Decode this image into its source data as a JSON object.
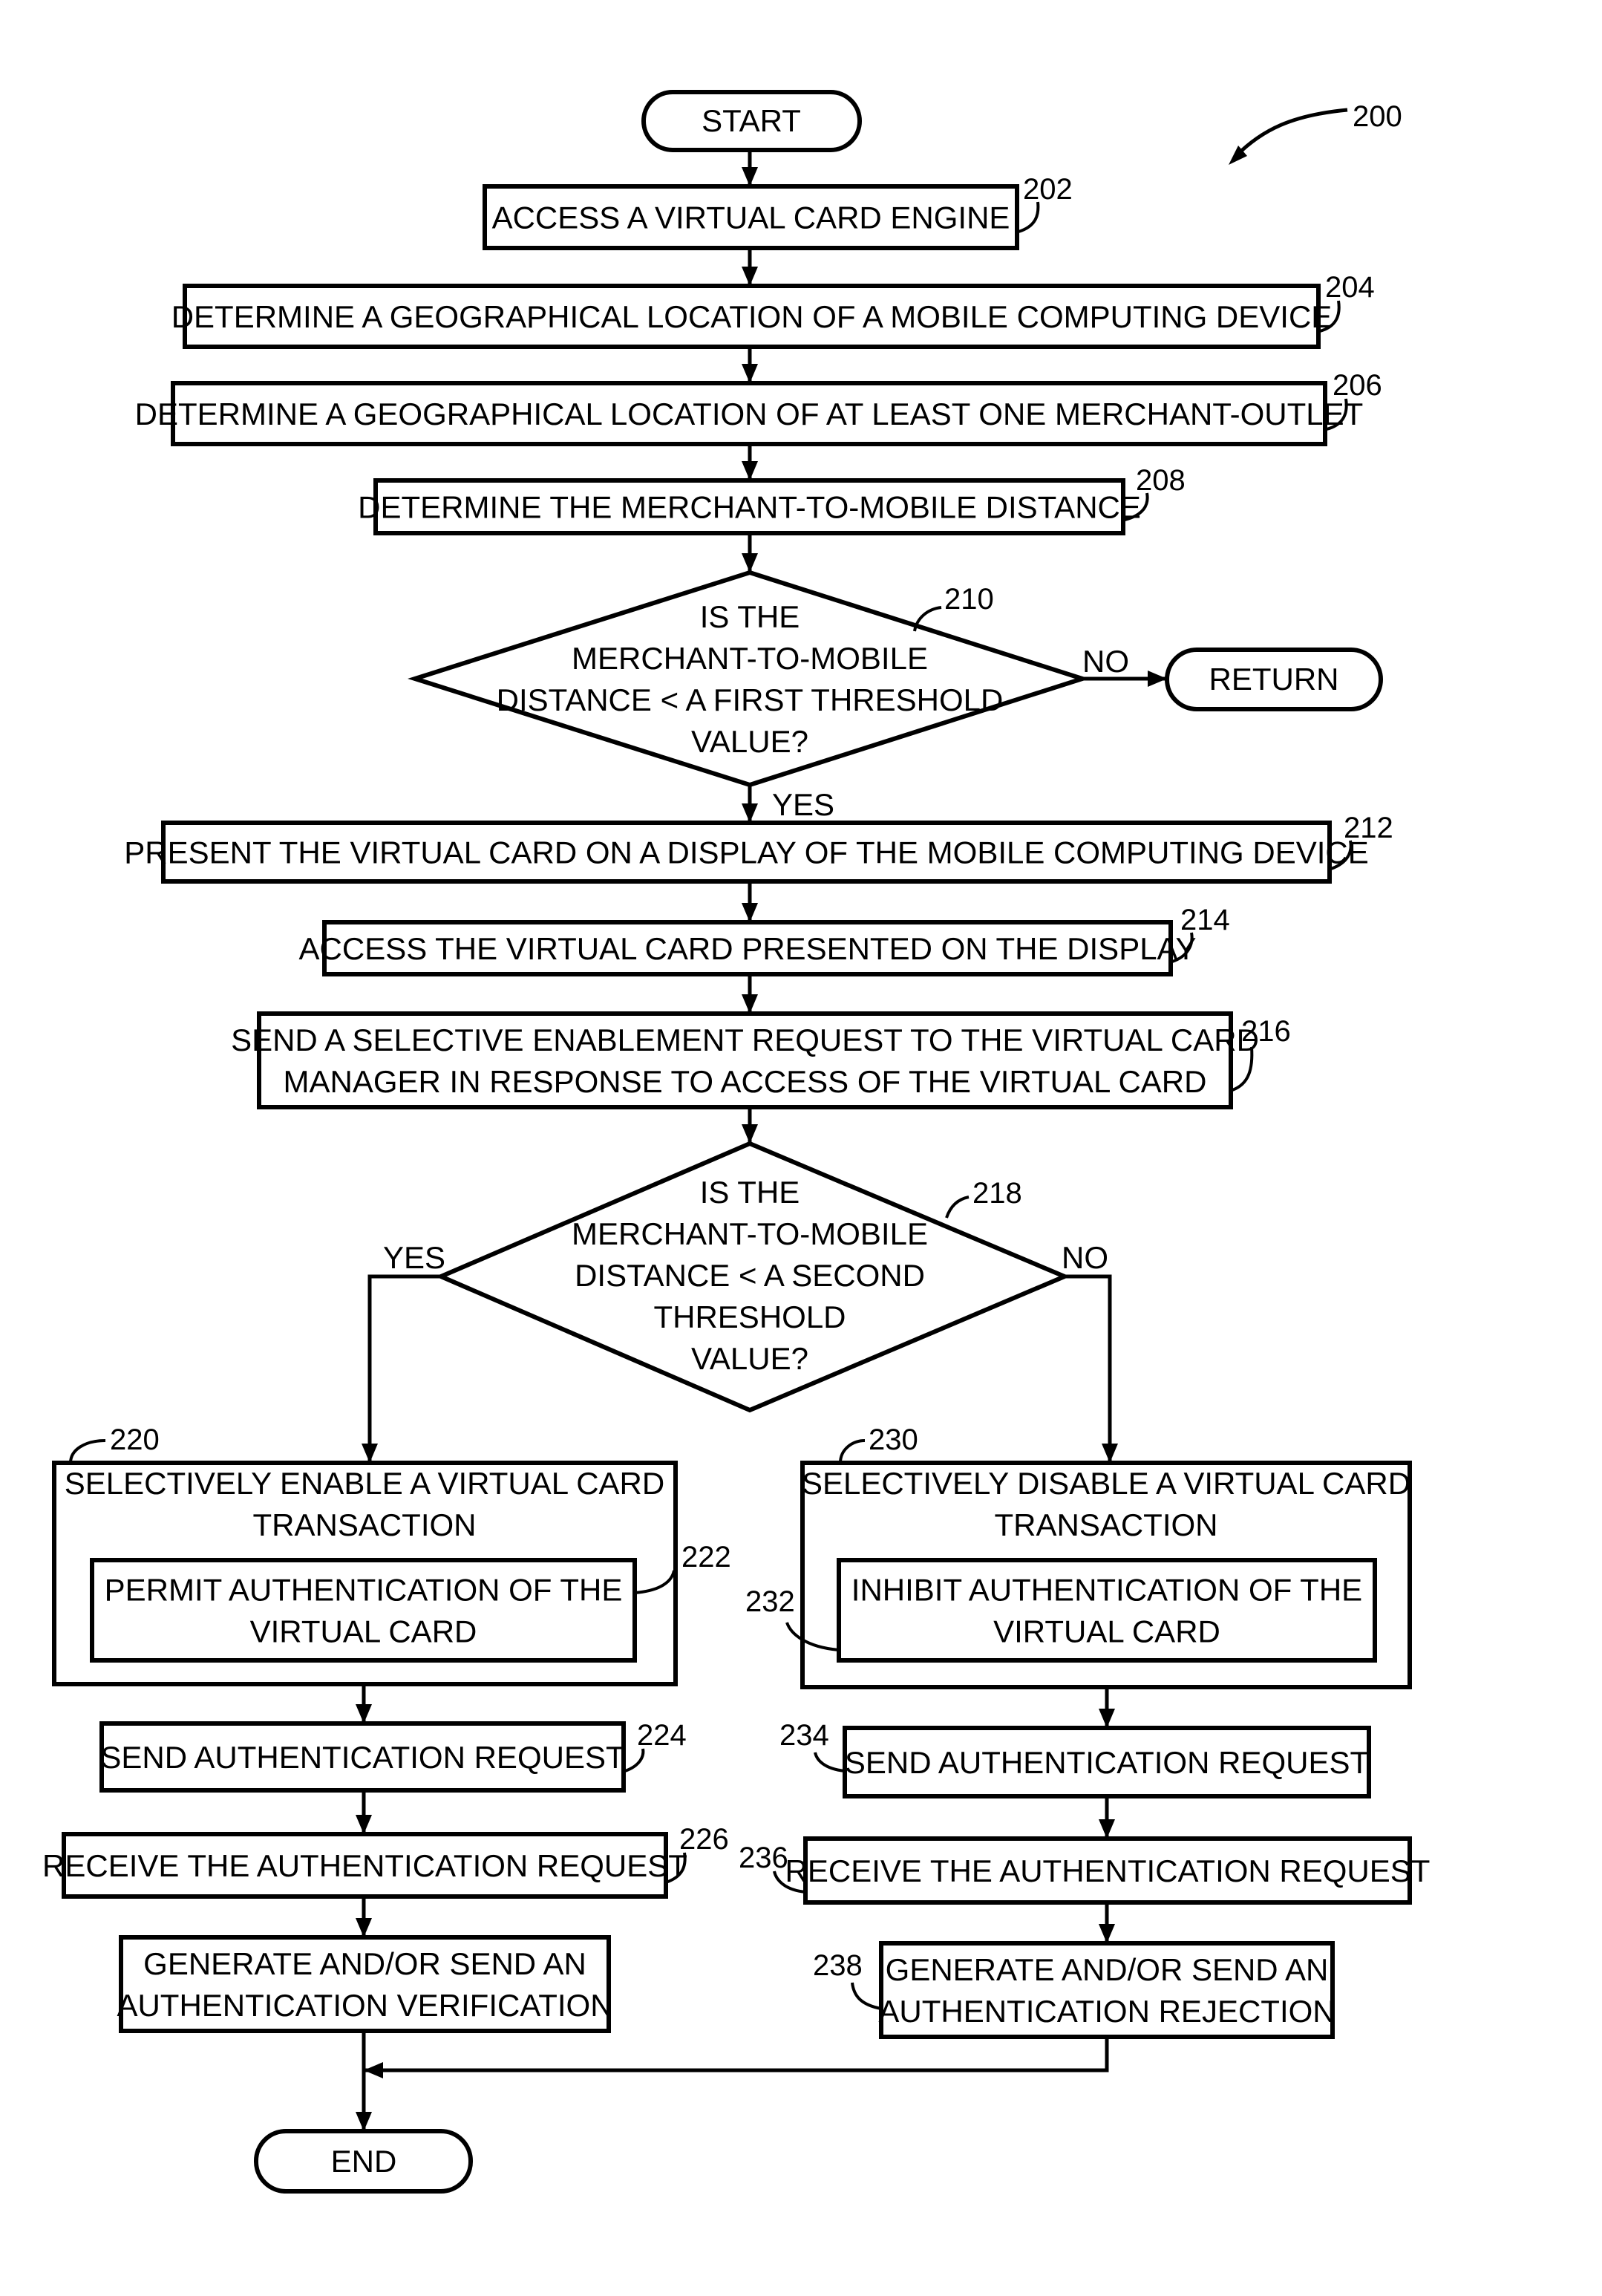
{
  "figure": {
    "ref": "200",
    "start": "START",
    "end": "END",
    "return": "RETURN",
    "steps": {
      "s202": {
        "ref": "202",
        "lines": [
          "ACCESS A VIRTUAL CARD ENGINE"
        ]
      },
      "s204": {
        "ref": "204",
        "lines": [
          "DETERMINE A GEOGRAPHICAL LOCATION OF A MOBILE COMPUTING DEVICE"
        ]
      },
      "s206": {
        "ref": "206",
        "lines": [
          "DETERMINE A GEOGRAPHICAL LOCATION OF AT LEAST ONE MERCHANT-OUTLET"
        ]
      },
      "s208": {
        "ref": "208",
        "lines": [
          "DETERMINE THE MERCHANT-TO-MOBILE DISTANCE"
        ]
      },
      "s210": {
        "ref": "210",
        "lines": [
          "IS THE",
          "MERCHANT-TO-MOBILE",
          "DISTANCE < A FIRST THRESHOLD",
          "VALUE?"
        ],
        "yes": "YES",
        "no": "NO"
      },
      "s212": {
        "ref": "212",
        "lines": [
          "PRESENT THE VIRTUAL CARD ON A DISPLAY OF THE MOBILE COMPUTING DEVICE"
        ]
      },
      "s214": {
        "ref": "214",
        "lines": [
          "ACCESS THE VIRTUAL CARD PRESENTED ON THE DISPLAY"
        ]
      },
      "s216": {
        "ref": "216",
        "lines": [
          "SEND A SELECTIVE ENABLEMENT REQUEST TO THE VIRTUAL CARD",
          "MANAGER IN RESPONSE TO ACCESS OF THE VIRTUAL CARD"
        ]
      },
      "s218": {
        "ref": "218",
        "lines": [
          "IS THE",
          "MERCHANT-TO-MOBILE",
          "DISTANCE < A SECOND",
          "THRESHOLD",
          "VALUE?"
        ],
        "yes": "YES",
        "no": "NO"
      },
      "s220": {
        "ref": "220",
        "lines": [
          "SELECTIVELY ENABLE A VIRTUAL CARD",
          "TRANSACTION"
        ]
      },
      "s222": {
        "ref": "222",
        "lines": [
          "PERMIT AUTHENTICATION OF THE",
          "VIRTUAL CARD"
        ]
      },
      "s224": {
        "ref": "224",
        "lines": [
          "SEND AUTHENTICATION REQUEST"
        ]
      },
      "s226": {
        "ref": "226",
        "lines": [
          "RECEIVE THE AUTHENTICATION REQUEST"
        ]
      },
      "s228": {
        "lines": [
          "GENERATE AND/OR SEND AN",
          "AUTHENTICATION VERIFICATION"
        ]
      },
      "s230": {
        "ref": "230",
        "lines": [
          "SELECTIVELY DISABLE A VIRTUAL CARD",
          "TRANSACTION"
        ]
      },
      "s232": {
        "ref": "232",
        "lines": [
          "INHIBIT AUTHENTICATION  OF THE",
          "VIRTUAL CARD"
        ]
      },
      "s234": {
        "ref": "234",
        "lines": [
          "SEND AUTHENTICATION REQUEST"
        ]
      },
      "s236": {
        "ref": "236",
        "lines": [
          "RECEIVE THE AUTHENTICATION REQUEST"
        ]
      },
      "s238": {
        "ref": "238",
        "lines": [
          "GENERATE AND/OR SEND AN",
          "AUTHENTICATION REJECTION"
        ]
      }
    }
  }
}
